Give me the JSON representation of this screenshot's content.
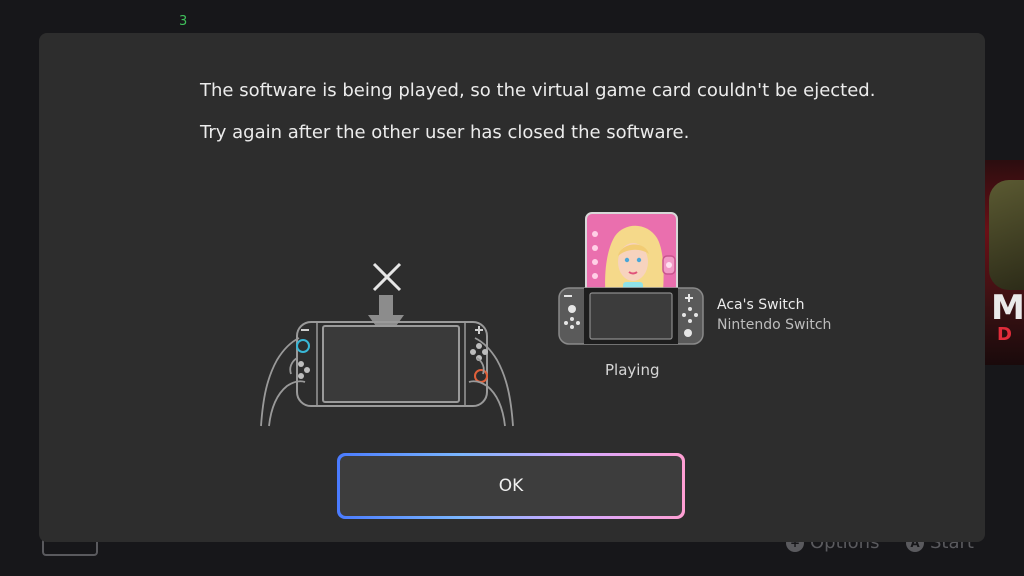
{
  "background": {
    "counter": "3",
    "art_text_1": "ME",
    "art_text_2": "D",
    "footer_options": "Options",
    "footer_start": "Start",
    "options_glyph": "+",
    "start_glyph": "A"
  },
  "dialog": {
    "message_line1": "The software is being played, so the virtual game card couldn't be ejected.",
    "message_line2": "Try again after the other user has closed the software.",
    "user_name": "Aca's Switch",
    "device_name": "Nintendo Switch",
    "status": "Playing",
    "ok_label": "OK"
  },
  "icons": [
    "close-x-icon",
    "down-arrow-icon",
    "hands-holding-switch-icon",
    "game-card-thumbnail",
    "switch-console-icon"
  ],
  "colors": {
    "dialog_bg": "#2d2d2d",
    "page_bg": "#17171a",
    "ok_border_start": "#4a7bff",
    "ok_border_end": "#ff9fd3",
    "card_pink": "#e86aa9"
  }
}
